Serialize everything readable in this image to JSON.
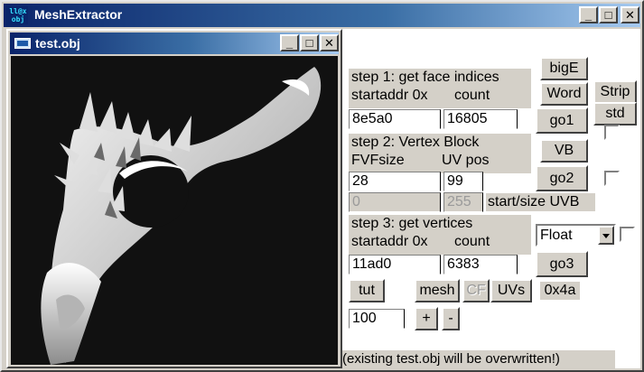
{
  "app": {
    "title": "MeshExtractor",
    "icon_text_top": "ll@x",
    "icon_text_bottom": "obj",
    "min_glyph": "_",
    "max_glyph": "□",
    "close_glyph": "✕"
  },
  "child": {
    "title": "test.obj",
    "colors": {
      "viewport_bg": "#111111",
      "mesh": "#e8e8e8"
    }
  },
  "step1": {
    "heading": "step 1: get face indices",
    "startaddr_label": "startaddr 0x",
    "count_label": "count",
    "startaddr_value": "8e5a0",
    "count_value": "16805",
    "bigE": "bigE",
    "word": "Word",
    "strip": "Strip",
    "std": "std",
    "go1": "go1"
  },
  "step2": {
    "heading": "step 2: Vertex Block",
    "fvfsize_label": "FVFsize",
    "uvpos_label": "UV pos",
    "fvfsize_value": "28",
    "uvpos_value": "99",
    "uvb_start_value": "0",
    "uvb_size_value": "255",
    "uvb_label": "start/size UVB",
    "vb": "VB",
    "go2": "go2"
  },
  "step3": {
    "heading": "step 3: get vertices",
    "startaddr_label": "startaddr 0x",
    "count_label": "count",
    "startaddr_value": "11ad0",
    "count_value": "6383",
    "format_selected": "Float",
    "go3": "go3"
  },
  "bottom": {
    "tut": "tut",
    "mesh": "mesh",
    "cf": "CF",
    "uvs": "UVs",
    "hex_value": "0x4a",
    "zoom_value": "100",
    "plus": "+",
    "minus": "-",
    "status": "(existing test.obj will be overwritten!)"
  }
}
